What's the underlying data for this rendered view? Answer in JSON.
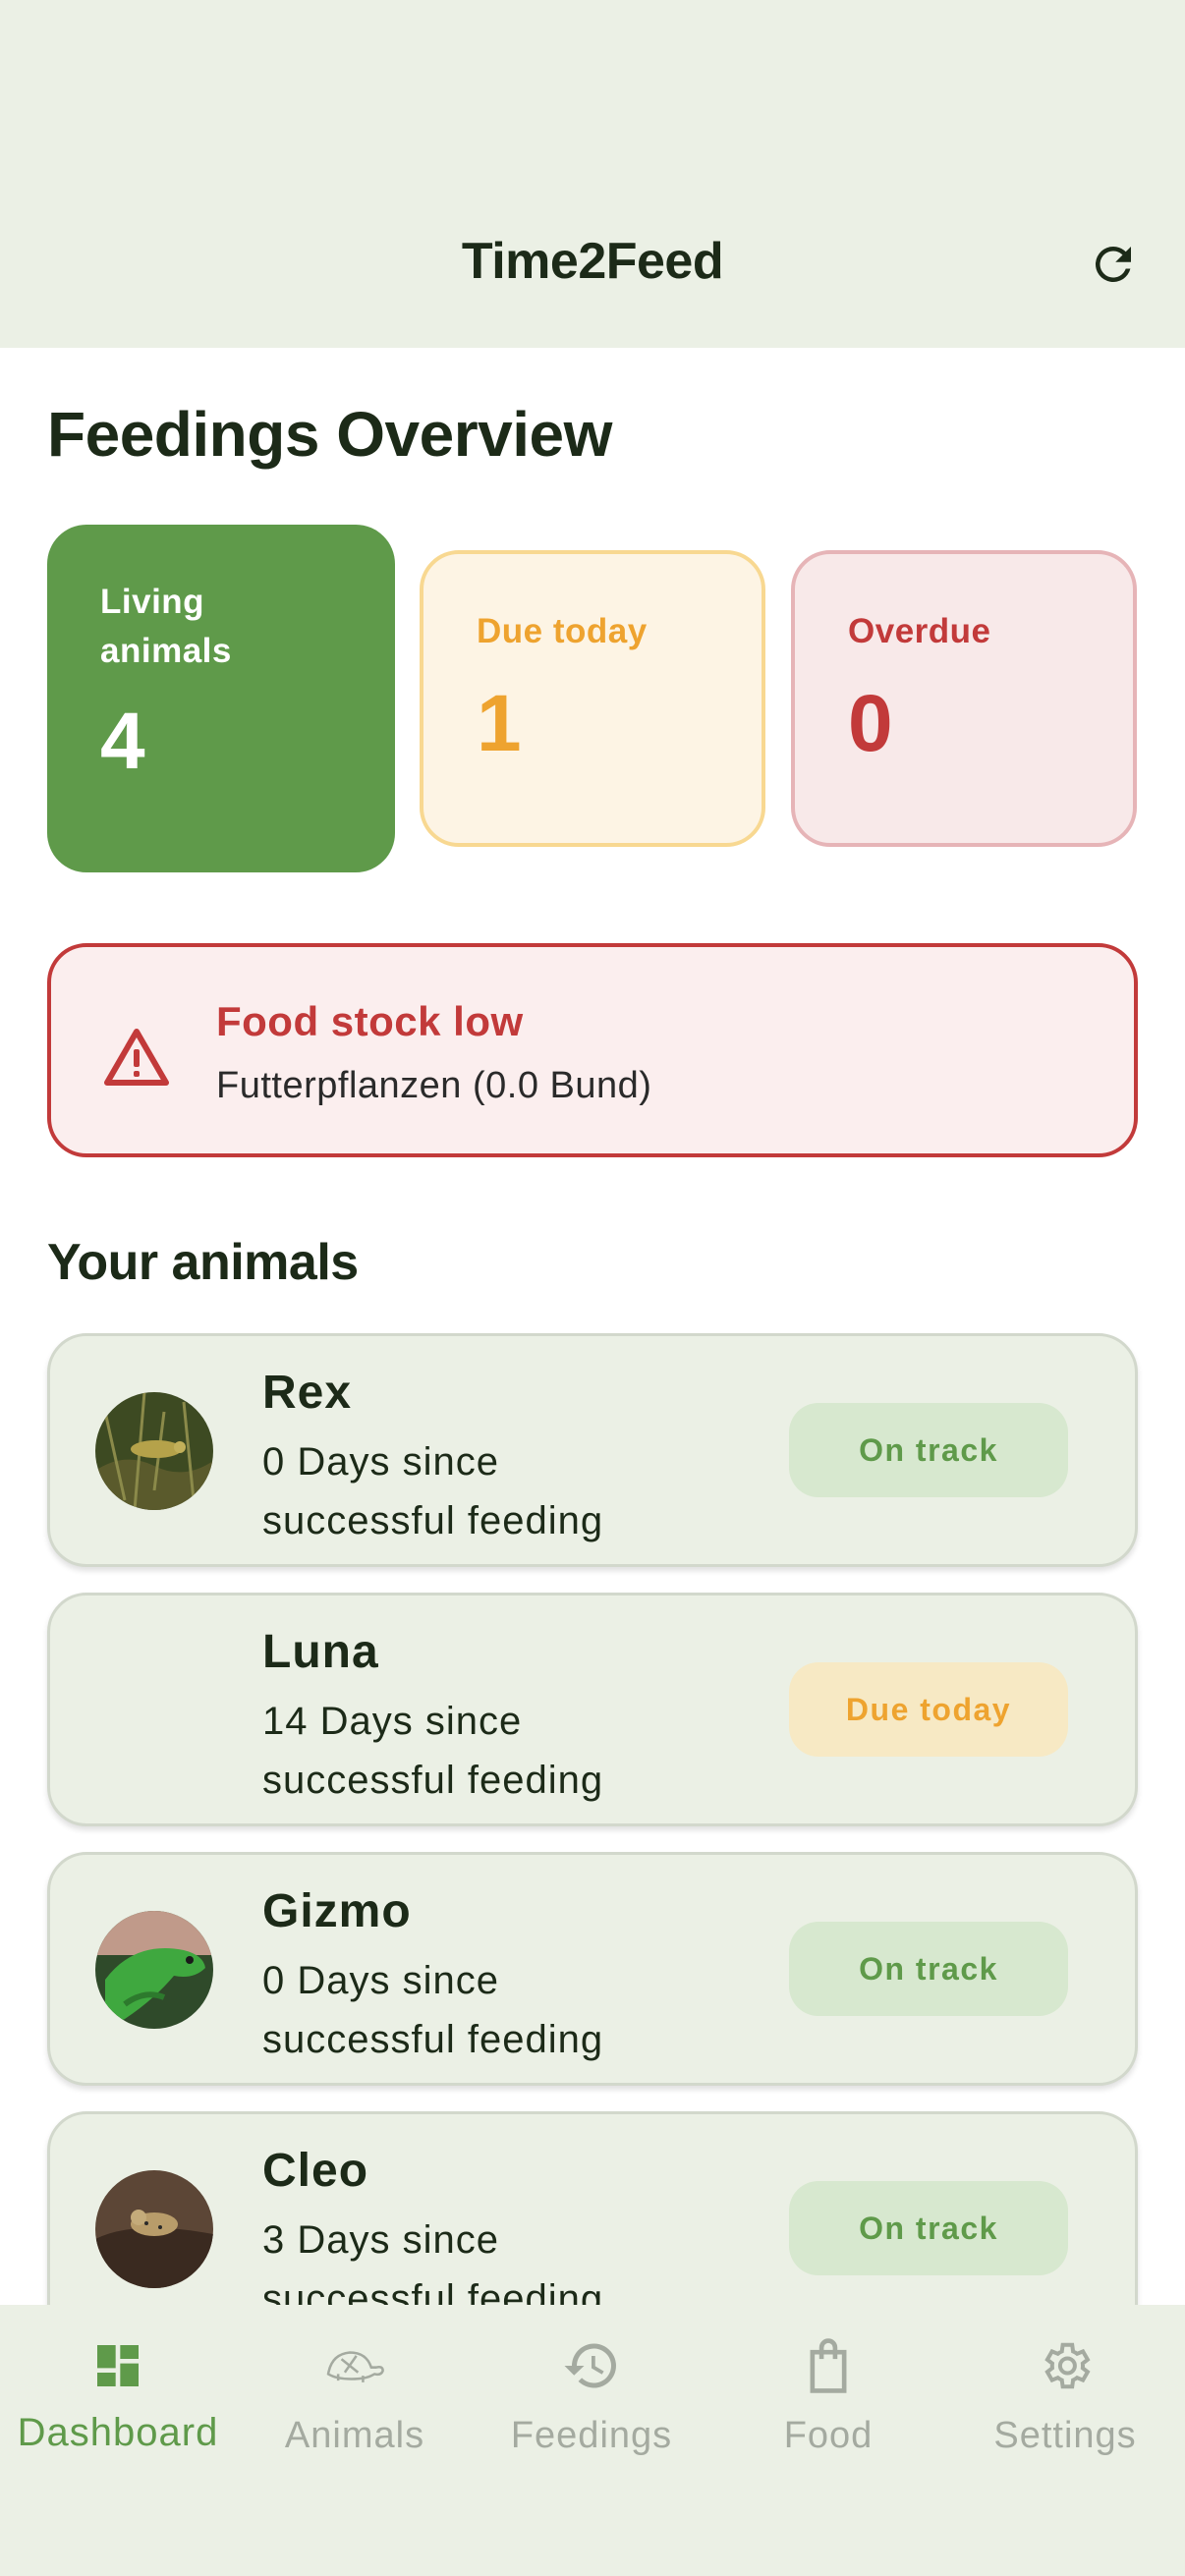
{
  "header": {
    "title": "Time2Feed",
    "refresh_icon": "refresh-icon"
  },
  "overview": {
    "title": "Feedings Overview",
    "living": {
      "label": "Living animals",
      "value": "4"
    },
    "due_today": {
      "label": "Due today",
      "value": "1"
    },
    "overdue": {
      "label": "Overdue",
      "value": "0"
    }
  },
  "alert": {
    "icon": "warning-icon",
    "title": "Food stock low",
    "text": "Futterpflanzen (0.0 Bund)"
  },
  "animals": {
    "title": "Your animals",
    "items": [
      {
        "name": "Rex",
        "subtitle": "0 Days since successful feeding",
        "status": "On track",
        "status_kind": "ok"
      },
      {
        "name": "Luna",
        "subtitle": "14 Days since successful feeding",
        "status": "Due today",
        "status_kind": "due"
      },
      {
        "name": "Gizmo",
        "subtitle": "0 Days since successful feeding",
        "status": "On track",
        "status_kind": "ok"
      },
      {
        "name": "Cleo",
        "subtitle": "3 Days since successful feeding",
        "status": "On track",
        "status_kind": "ok"
      }
    ]
  },
  "nav": {
    "items": [
      {
        "label": "Dashboard",
        "icon": "dashboard-icon",
        "active": true
      },
      {
        "label": "Animals",
        "icon": "turtle-icon",
        "active": false
      },
      {
        "label": "Feedings",
        "icon": "history-icon",
        "active": false
      },
      {
        "label": "Food",
        "icon": "shopping-bag-icon",
        "active": false
      },
      {
        "label": "Settings",
        "icon": "gear-icon",
        "active": false
      }
    ]
  },
  "colors": {
    "accent": "#5f9a4a",
    "warning": "#eea32f",
    "danger": "#c23a3a",
    "surface": "#ebf0e5"
  }
}
